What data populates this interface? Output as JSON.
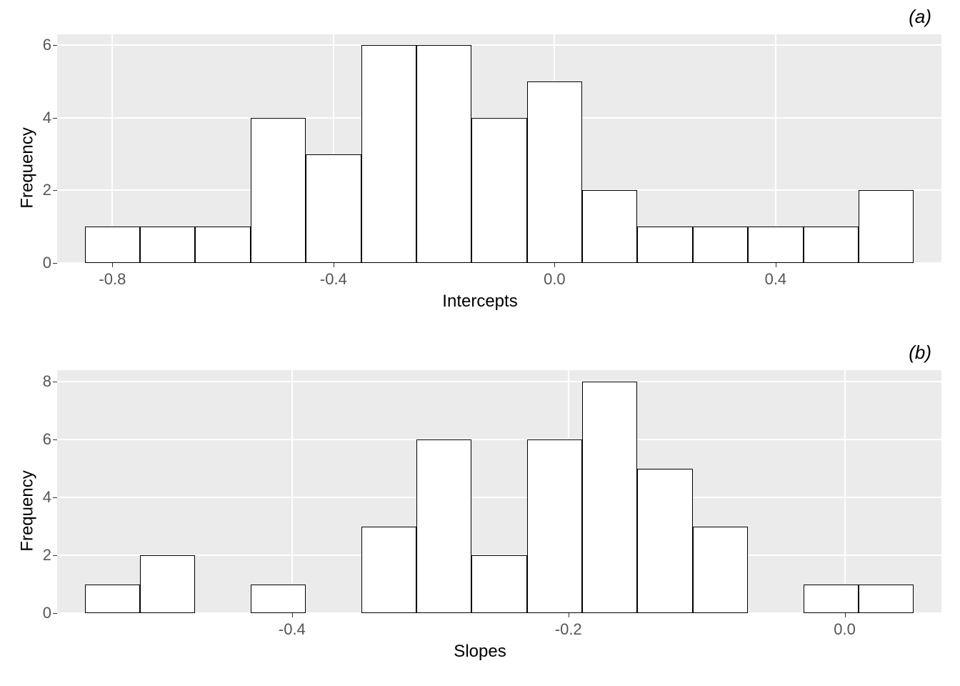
{
  "chart_data": [
    {
      "type": "bar",
      "title": "(a)",
      "xlabel": "Intercepts",
      "ylabel": "Frequency",
      "ylim": [
        0,
        6.3
      ],
      "xlim": [
        -0.9,
        0.7
      ],
      "bin_width": 0.1,
      "bin_left_edges": [
        -0.85,
        -0.75,
        -0.65,
        -0.55,
        -0.45,
        -0.35,
        -0.25,
        -0.15,
        -0.05,
        0.05,
        0.15,
        0.25,
        0.35,
        0.45,
        0.55
      ],
      "values": [
        1,
        1,
        1,
        4,
        3,
        6,
        6,
        4,
        5,
        2,
        1,
        1,
        1,
        1,
        2
      ],
      "y_ticks": [
        0,
        2,
        4,
        6
      ],
      "x_ticks": [
        -0.8,
        -0.4,
        0.0,
        0.4
      ],
      "x_tick_labels": [
        "-0.8",
        "-0.4",
        "0.0",
        "0.4"
      ]
    },
    {
      "type": "bar",
      "title": "(b)",
      "xlabel": "Slopes",
      "ylabel": "Frequency",
      "ylim": [
        0,
        8.4
      ],
      "xlim": [
        -0.57,
        0.07
      ],
      "bin_width": 0.04,
      "bin_left_edges": [
        -0.55,
        -0.51,
        -0.47,
        -0.43,
        -0.39,
        -0.35,
        -0.31,
        -0.27,
        -0.23,
        -0.19,
        -0.15,
        -0.11,
        -0.07,
        -0.03,
        0.01
      ],
      "values": [
        1,
        2,
        0,
        1,
        0,
        3,
        6,
        2,
        6,
        8,
        5,
        3,
        0,
        1,
        1
      ],
      "y_ticks": [
        0,
        2,
        4,
        6,
        8
      ],
      "x_ticks": [
        -0.4,
        -0.2,
        0.0
      ],
      "x_tick_labels": [
        "-0.4",
        "-0.2",
        "0.0"
      ]
    }
  ]
}
